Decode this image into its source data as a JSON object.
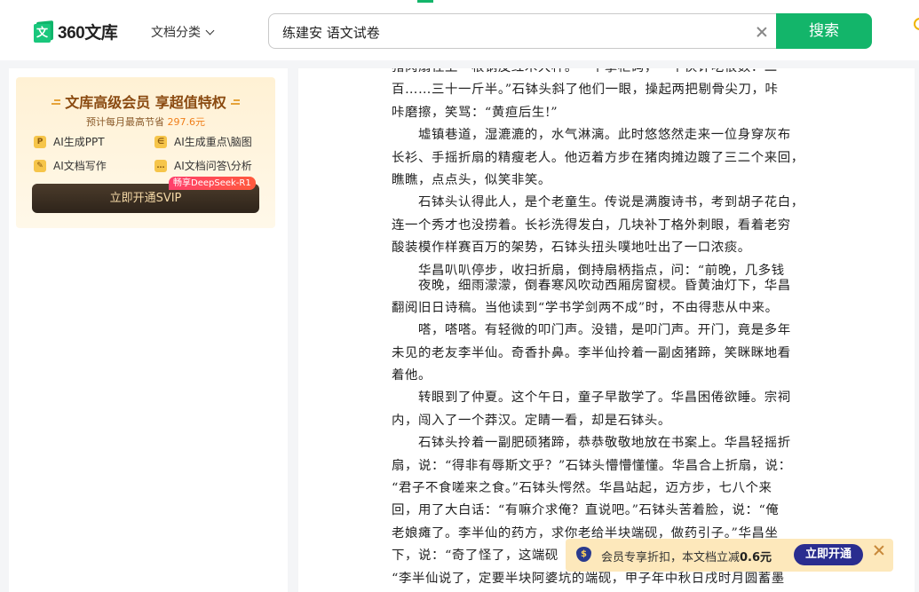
{
  "header": {
    "logo_text": "360文库",
    "logo_mark": "文",
    "doc_category": "文档分类",
    "search_value": "练建安 语文试卷",
    "search_button": "搜索"
  },
  "vip_card": {
    "title": "文库高级会员 享超值特权",
    "subtitle_prefix": "预计每月最高节省",
    "subtitle_amount": "297.6元",
    "features": [
      {
        "icon": "P",
        "label": "AI生成PPT"
      },
      {
        "icon": "∈",
        "label": "AI生成重点\\脑图"
      },
      {
        "icon": "✎",
        "label": "AI文档写作"
      },
      {
        "icon": "…",
        "label": "AI文档问答\\分析"
      }
    ],
    "deepseek_tag": "畅享DeepSeek-R1",
    "svip_button": "立即开通SVIP"
  },
  "document": {
    "lines": [
      "猪肉扇往上一根钢皮红木大杆。一个掌柜码，一个伙计吃很数：二",
      "百……三十一斤半。”石钵头斜了他们一眼，操起两把剔骨尖刀，咔",
      "咔磨擦，笑骂：“黄疸后生!”",
      "　　墟镇巷道，湿漉漉的，水气淋漓。此时悠悠然走来一位身穿灰布",
      "长衫、手摇折扇的精瘦老人。他迈着方步在猪肉摊边踱了三二个来回，",
      "瞧瞧，点点头，似笑非笑。",
      "　　石钵头认得此人，是个老童生。传说是满腹诗书，考到胡子花白，",
      "连一个秀才也没捞着。长衫洗得发白，几块补丁格外刺眼，看着老穷",
      "酸装模作样赛百万的架势，石钵头扭头噗地吐出了一口浓痰。",
      "　　华昌叭叭停步，收扫折扇，倒持扇柄指点，问：“前晚，几多钱",
      "　　夜晚，细雨濛濛，倒春寒风吹动西厢房窗棂。昏黄油灯下，华昌",
      "翻阅旧日诗稿。当他读到“学书学剑两不成”时，不由得悲从中来。",
      "　　嗒，嗒嗒。有轻微的叩门声。没错，是叩门声。开门，竟是多年",
      "未见的老友李半仙。奇香扑鼻。李半仙拎着一副卤猪蹄，笑眯眯地看",
      "着他。",
      "　　转眼到了仲夏。这个午日，童子早散学了。华昌困倦欲睡。宗祠",
      "内，闯入了一个莽汉。定睛一看，却是石钵头。",
      "　　石钵头拎着一副肥硕猪蹄，恭恭敬敬地放在书案上。华昌轻摇折",
      "扇，说：“得非有辱斯文乎？”石钵头懵懵懂懂。华昌合上折扇，说：",
      "“君子不食嗟来之食。”石钵头愕然。华昌站起，迈方步，七八个来",
      "回，用了大白话：“有嘛介求俺？直说吧。”石钵头苦着脸，说：“俺",
      "老娘瘫了。李半仙的药方，求你老给半块端砚，做药引子。”华昌坐",
      "下，说：“奇了怪了，这端砚",
      "“李半仙说了，定要半块阿婆坑的端砚，甲子年中秋日戌时月圆蓄墨"
    ]
  },
  "promo": {
    "icon": "$",
    "text_prefix": "会员专享折扣，本文档立减",
    "text_amount": "0.6元",
    "button": "立即开通"
  }
}
